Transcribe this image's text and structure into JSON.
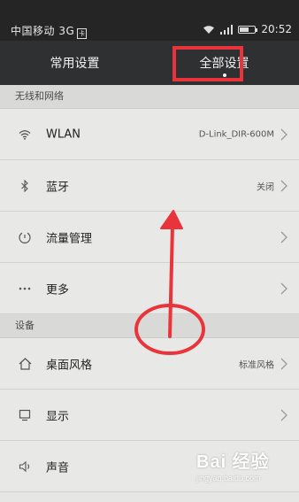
{
  "status_bar": {
    "carrier": "中国移动 3G",
    "sim_label": "卡",
    "time": "20:52",
    "battery_level": 0.6
  },
  "tabs": [
    {
      "label": "常用设置",
      "active": false
    },
    {
      "label": "全部设置",
      "active": true
    }
  ],
  "sections": {
    "network": {
      "header": "无线和网络",
      "items": {
        "wlan": {
          "label": "WLAN",
          "value": "D-Link_DIR-600M",
          "icon": "wifi-icon"
        },
        "bluetooth": {
          "label": "蓝牙",
          "value": "关闭",
          "icon": "bluetooth-icon"
        },
        "data_usage": {
          "label": "流量管理",
          "value": "",
          "icon": "data-usage-icon"
        },
        "more": {
          "label": "更多",
          "value": "",
          "icon": "more-icon"
        }
      }
    },
    "device": {
      "header": "设备",
      "items": {
        "home_style": {
          "label": "桌面风格",
          "value": "标准风格",
          "icon": "home-icon"
        },
        "display": {
          "label": "显示",
          "value": "",
          "icon": "display-icon"
        },
        "sound": {
          "label": "声音",
          "value": "",
          "icon": "sound-icon"
        }
      }
    }
  },
  "annotation": {
    "color": "#e8343a"
  },
  "watermark": {
    "brand": "Bai 经验",
    "url": "jingyan.baidu.com"
  }
}
